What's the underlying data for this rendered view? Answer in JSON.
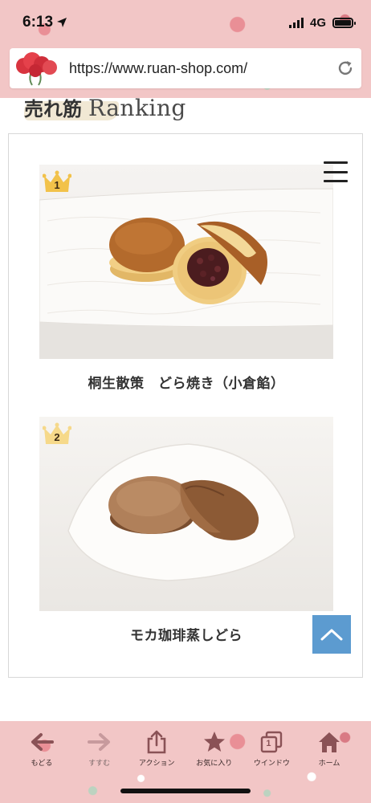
{
  "status_bar": {
    "time": "6:13",
    "network": "4G"
  },
  "browser": {
    "url": "https://www.ruan-shop.com/"
  },
  "section": {
    "heading_jp": "売れ筋",
    "heading_en": "Ranking"
  },
  "products": [
    {
      "rank": "1",
      "name": "桐生散策　どら焼き（小倉餡）"
    },
    {
      "rank": "2",
      "name": "モカ珈琲蒸しどら"
    }
  ],
  "toolbar": {
    "back": "もどる",
    "forward": "すすむ",
    "action": "アクション",
    "favorites": "お気に入り",
    "windows": "ウインドウ",
    "windows_count": "1",
    "home": "ホーム"
  },
  "colors": {
    "floral_pink": "#f2c6c6",
    "to_top_blue": "#5c9bd0",
    "toolbar_icon": "#8a5256"
  }
}
